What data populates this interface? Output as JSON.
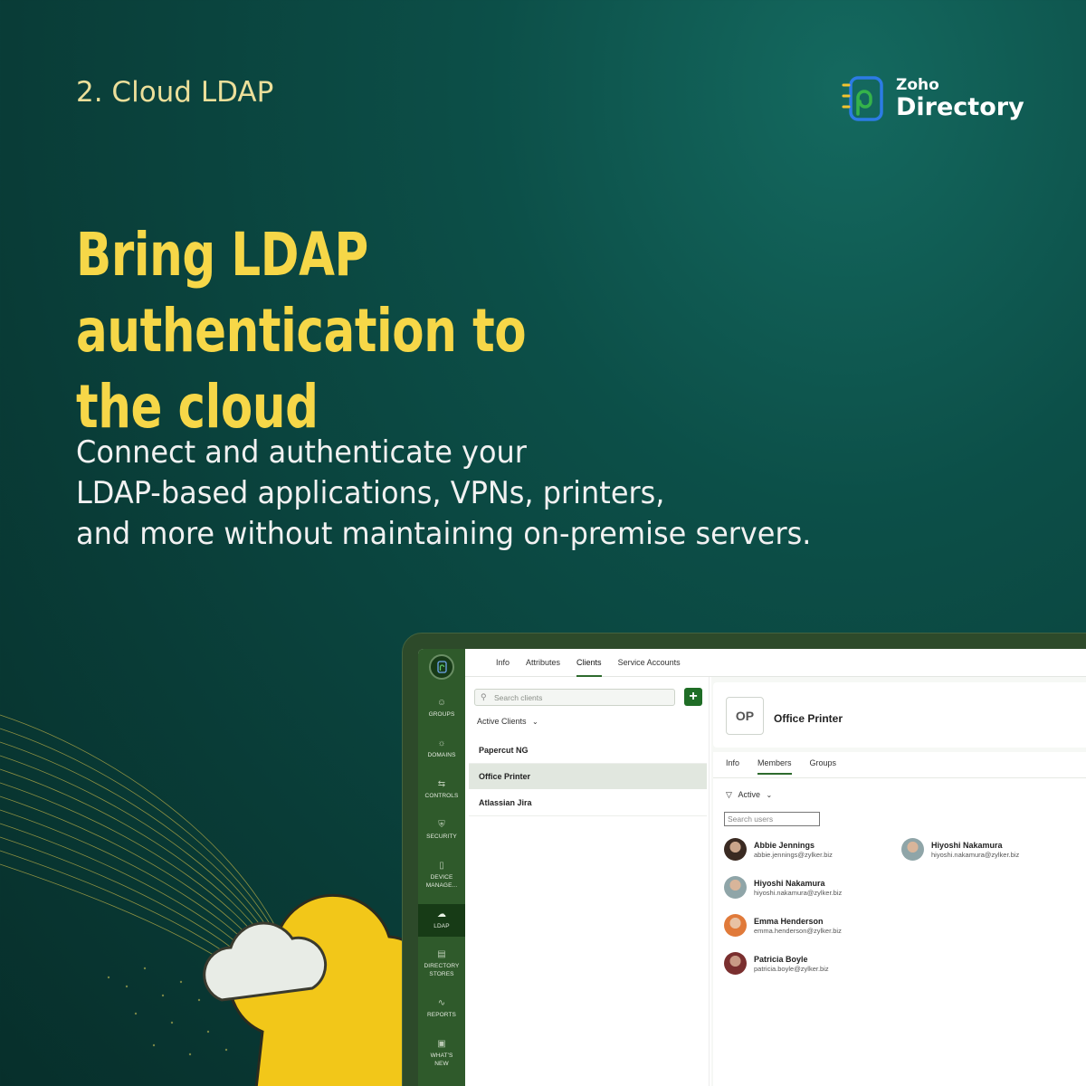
{
  "section_label": "2. Cloud LDAP",
  "logo": {
    "small": "Zoho",
    "big": "Directory"
  },
  "headline": {
    "line1": "Bring LDAP authentication to",
    "line2": "the cloud"
  },
  "subtext": {
    "line1": "Connect and authenticate your",
    "line2": "LDAP-based applications, VPNs, printers,",
    "line3": "and more without maintaining on-premise servers."
  },
  "colors": {
    "accent_yellow": "#f6d748",
    "brand_green": "#2f5a2b",
    "background": "#093c37"
  },
  "sidebar": {
    "items": [
      {
        "label": "GROUPS",
        "icon": "groups-icon"
      },
      {
        "label": "DOMAINS",
        "icon": "globe-icon"
      },
      {
        "label": "CONTROLS",
        "icon": "controls-icon"
      },
      {
        "label": "SECURITY",
        "icon": "shield-icon"
      },
      {
        "label": "DEVICE MANAGE...",
        "icon": "device-icon"
      },
      {
        "label": "LDAP",
        "icon": "cloud-icon"
      },
      {
        "label": "DIRECTORY STORES",
        "icon": "directory-store-icon"
      },
      {
        "label": "REPORTS",
        "icon": "reports-icon"
      },
      {
        "label": "WHAT'S NEW",
        "icon": "gift-icon"
      }
    ],
    "active": "LDAP"
  },
  "top_tabs": [
    "Info",
    "Attributes",
    "Clients",
    "Service Accounts"
  ],
  "top_tab_active": "Clients",
  "clients_panel": {
    "search_placeholder": "Search clients",
    "add_label": "+",
    "filter_label": "Active Clients",
    "clients": [
      "Papercut NG",
      "Office Printer",
      "Atlassian Jira"
    ],
    "selected": "Office Printer"
  },
  "detail": {
    "initials": "OP",
    "name": "Office Printer",
    "tabs": [
      "Info",
      "Members",
      "Groups"
    ],
    "active_tab": "Members",
    "filter_label": "Active",
    "search_users_placeholder": "Search users",
    "members": [
      {
        "name": "Abbie Jennings",
        "email": "abbie.jennings@zylker.biz"
      },
      {
        "name": "Hiyoshi Nakamura",
        "email": "hiyoshi.nakamura@zylker.biz"
      },
      {
        "name": "Hiyoshi Nakamura",
        "email": "hiyoshi.nakamura@zylker.biz"
      },
      {
        "name": "Emma Henderson",
        "email": "emma.henderson@zylker.biz"
      },
      {
        "name": "Patricia Boyle",
        "email": "patricia.boyle@zylker.biz"
      }
    ]
  }
}
